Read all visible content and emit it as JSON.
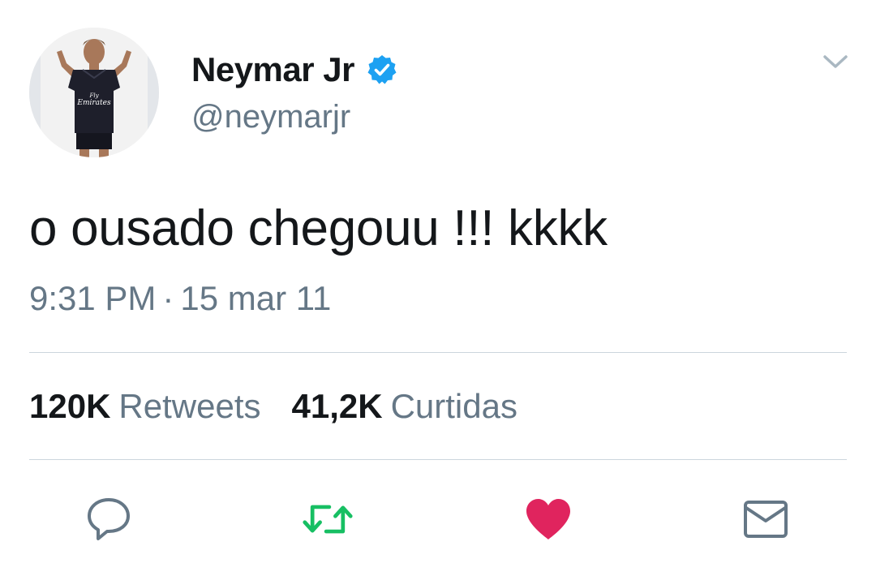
{
  "user": {
    "display_name": "Neymar Jr",
    "handle": "@neymarjr",
    "verified": true,
    "avatar_shirt_text": "Fly Emirates"
  },
  "tweet": {
    "text": "o ousado chegouu !!! kkkk",
    "time": "9:31 PM",
    "separator": "·",
    "date": "15 mar 11"
  },
  "stats": {
    "retweets_count": "120K",
    "retweets_label": "Retweets",
    "likes_count": "41,2K",
    "likes_label": "Curtidas"
  },
  "actions": {
    "reply_icon": "reply-icon",
    "retweet_icon": "retweet-icon",
    "like_icon": "heart-icon",
    "dm_icon": "envelope-icon"
  },
  "colors": {
    "verified": "#1da1f2",
    "retweet": "#17bf63",
    "like": "#e0245e",
    "secondary_text": "#657786",
    "icon_gray": "#657786",
    "divider": "#ccd6dd"
  }
}
